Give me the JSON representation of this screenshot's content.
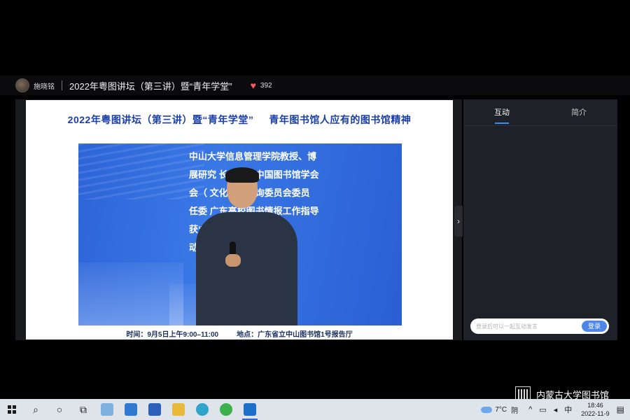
{
  "header": {
    "username": "施晓铭",
    "title": "2022年粤图讲坛（第三讲）暨“青年学堂”",
    "likes": "392"
  },
  "slide": {
    "header_main": "2022年粤图讲坛（第三讲）暨“青年学堂”",
    "header_sub": "青年图书馆人应有的图书馆精神",
    "screen_lines": [
      "中山大学信息管理学院教授、博",
      "展研究    长。兼任中国图书馆学会",
      "会（   文化遗产咨询委员会委员",
      "任委     广东高校图书情报工作指导",
      "                 获“享受国务院政",
      "                动30余项。"
    ],
    "time": "时间：9月5日上午9:00–11:00",
    "place": "地点：广东省立中山图书馆1号报告厅"
  },
  "panel": {
    "tabs": [
      {
        "label": "互动",
        "active": true
      },
      {
        "label": "简介",
        "active": false
      }
    ],
    "input_placeholder": "登录后可以一起互动发言",
    "login_label": "登录"
  },
  "watermark": {
    "text": "内蒙古大学图书馆"
  },
  "taskbar": {
    "weather_temp": "7°C",
    "weather_cond": "阴",
    "time": "18:46",
    "date": "2022-11-9",
    "accent": "#2d6bd6"
  }
}
